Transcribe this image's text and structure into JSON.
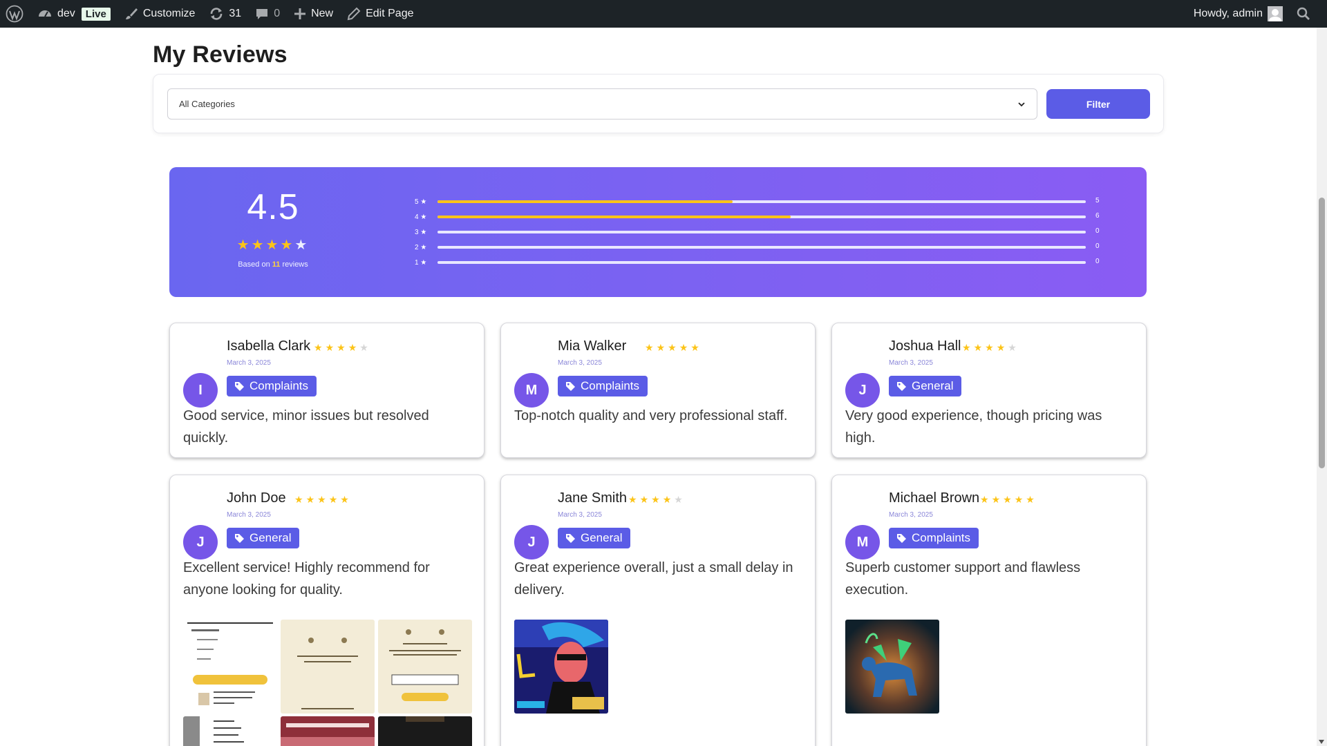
{
  "adminbar": {
    "site_name": "dev",
    "live_badge": "Live",
    "customize": "Customize",
    "updates_count": "31",
    "comments_count": "0",
    "new_label": "New",
    "edit_page": "Edit Page",
    "howdy": "Howdy, admin"
  },
  "page": {
    "title": "My Reviews"
  },
  "filter": {
    "selected_category": "All Categories",
    "button_label": "Filter"
  },
  "summary": {
    "average": "4.5",
    "average_value": 4.5,
    "based_prefix": "Based on",
    "review_count": "11",
    "based_suffix": "reviews",
    "star_on_color": "#fcc419",
    "distribution": [
      {
        "label": "5 ★",
        "count": "5",
        "fill_fraction": 0.455
      },
      {
        "label": "4 ★",
        "count": "6",
        "fill_fraction": 0.545
      },
      {
        "label": "3 ★",
        "count": "0",
        "fill_fraction": 0
      },
      {
        "label": "2 ★",
        "count": "0",
        "fill_fraction": 0
      },
      {
        "label": "1 ★",
        "count": "0",
        "fill_fraction": 0
      }
    ]
  },
  "reviews": [
    {
      "initial": "I",
      "name": "Isabella Clark",
      "rating": 4,
      "date": "March 3, 2025",
      "category": "Complaints",
      "text": "Good service, minor issues but resolved quickly."
    },
    {
      "initial": "M",
      "name": "Mia Walker",
      "rating": 5,
      "date": "March 3, 2025",
      "category": "Complaints",
      "text": "Top-notch quality and very professional staff."
    },
    {
      "initial": "J",
      "name": "Joshua Hall",
      "rating": 4,
      "date": "March 3, 2025",
      "category": "General",
      "text": "Very good experience, though pricing was high."
    },
    {
      "initial": "J",
      "name": "John Doe",
      "rating": 5,
      "date": "March 3, 2025",
      "category": "General",
      "text": "Excellent service! Highly recommend for anyone looking for quality."
    },
    {
      "initial": "J",
      "name": "Jane Smith",
      "rating": 4,
      "date": "March 3, 2025",
      "category": "General",
      "text": "Great experience overall, just a small delay in delivery."
    },
    {
      "initial": "M",
      "name": "Michael Brown",
      "rating": 5,
      "date": "March 3, 2025",
      "category": "Complaints",
      "text": "Superb customer support and flawless execution."
    }
  ],
  "colors": {
    "accent": "#5b5ce6",
    "avatar": "#7656e8",
    "adminbar": "#1d2327"
  }
}
